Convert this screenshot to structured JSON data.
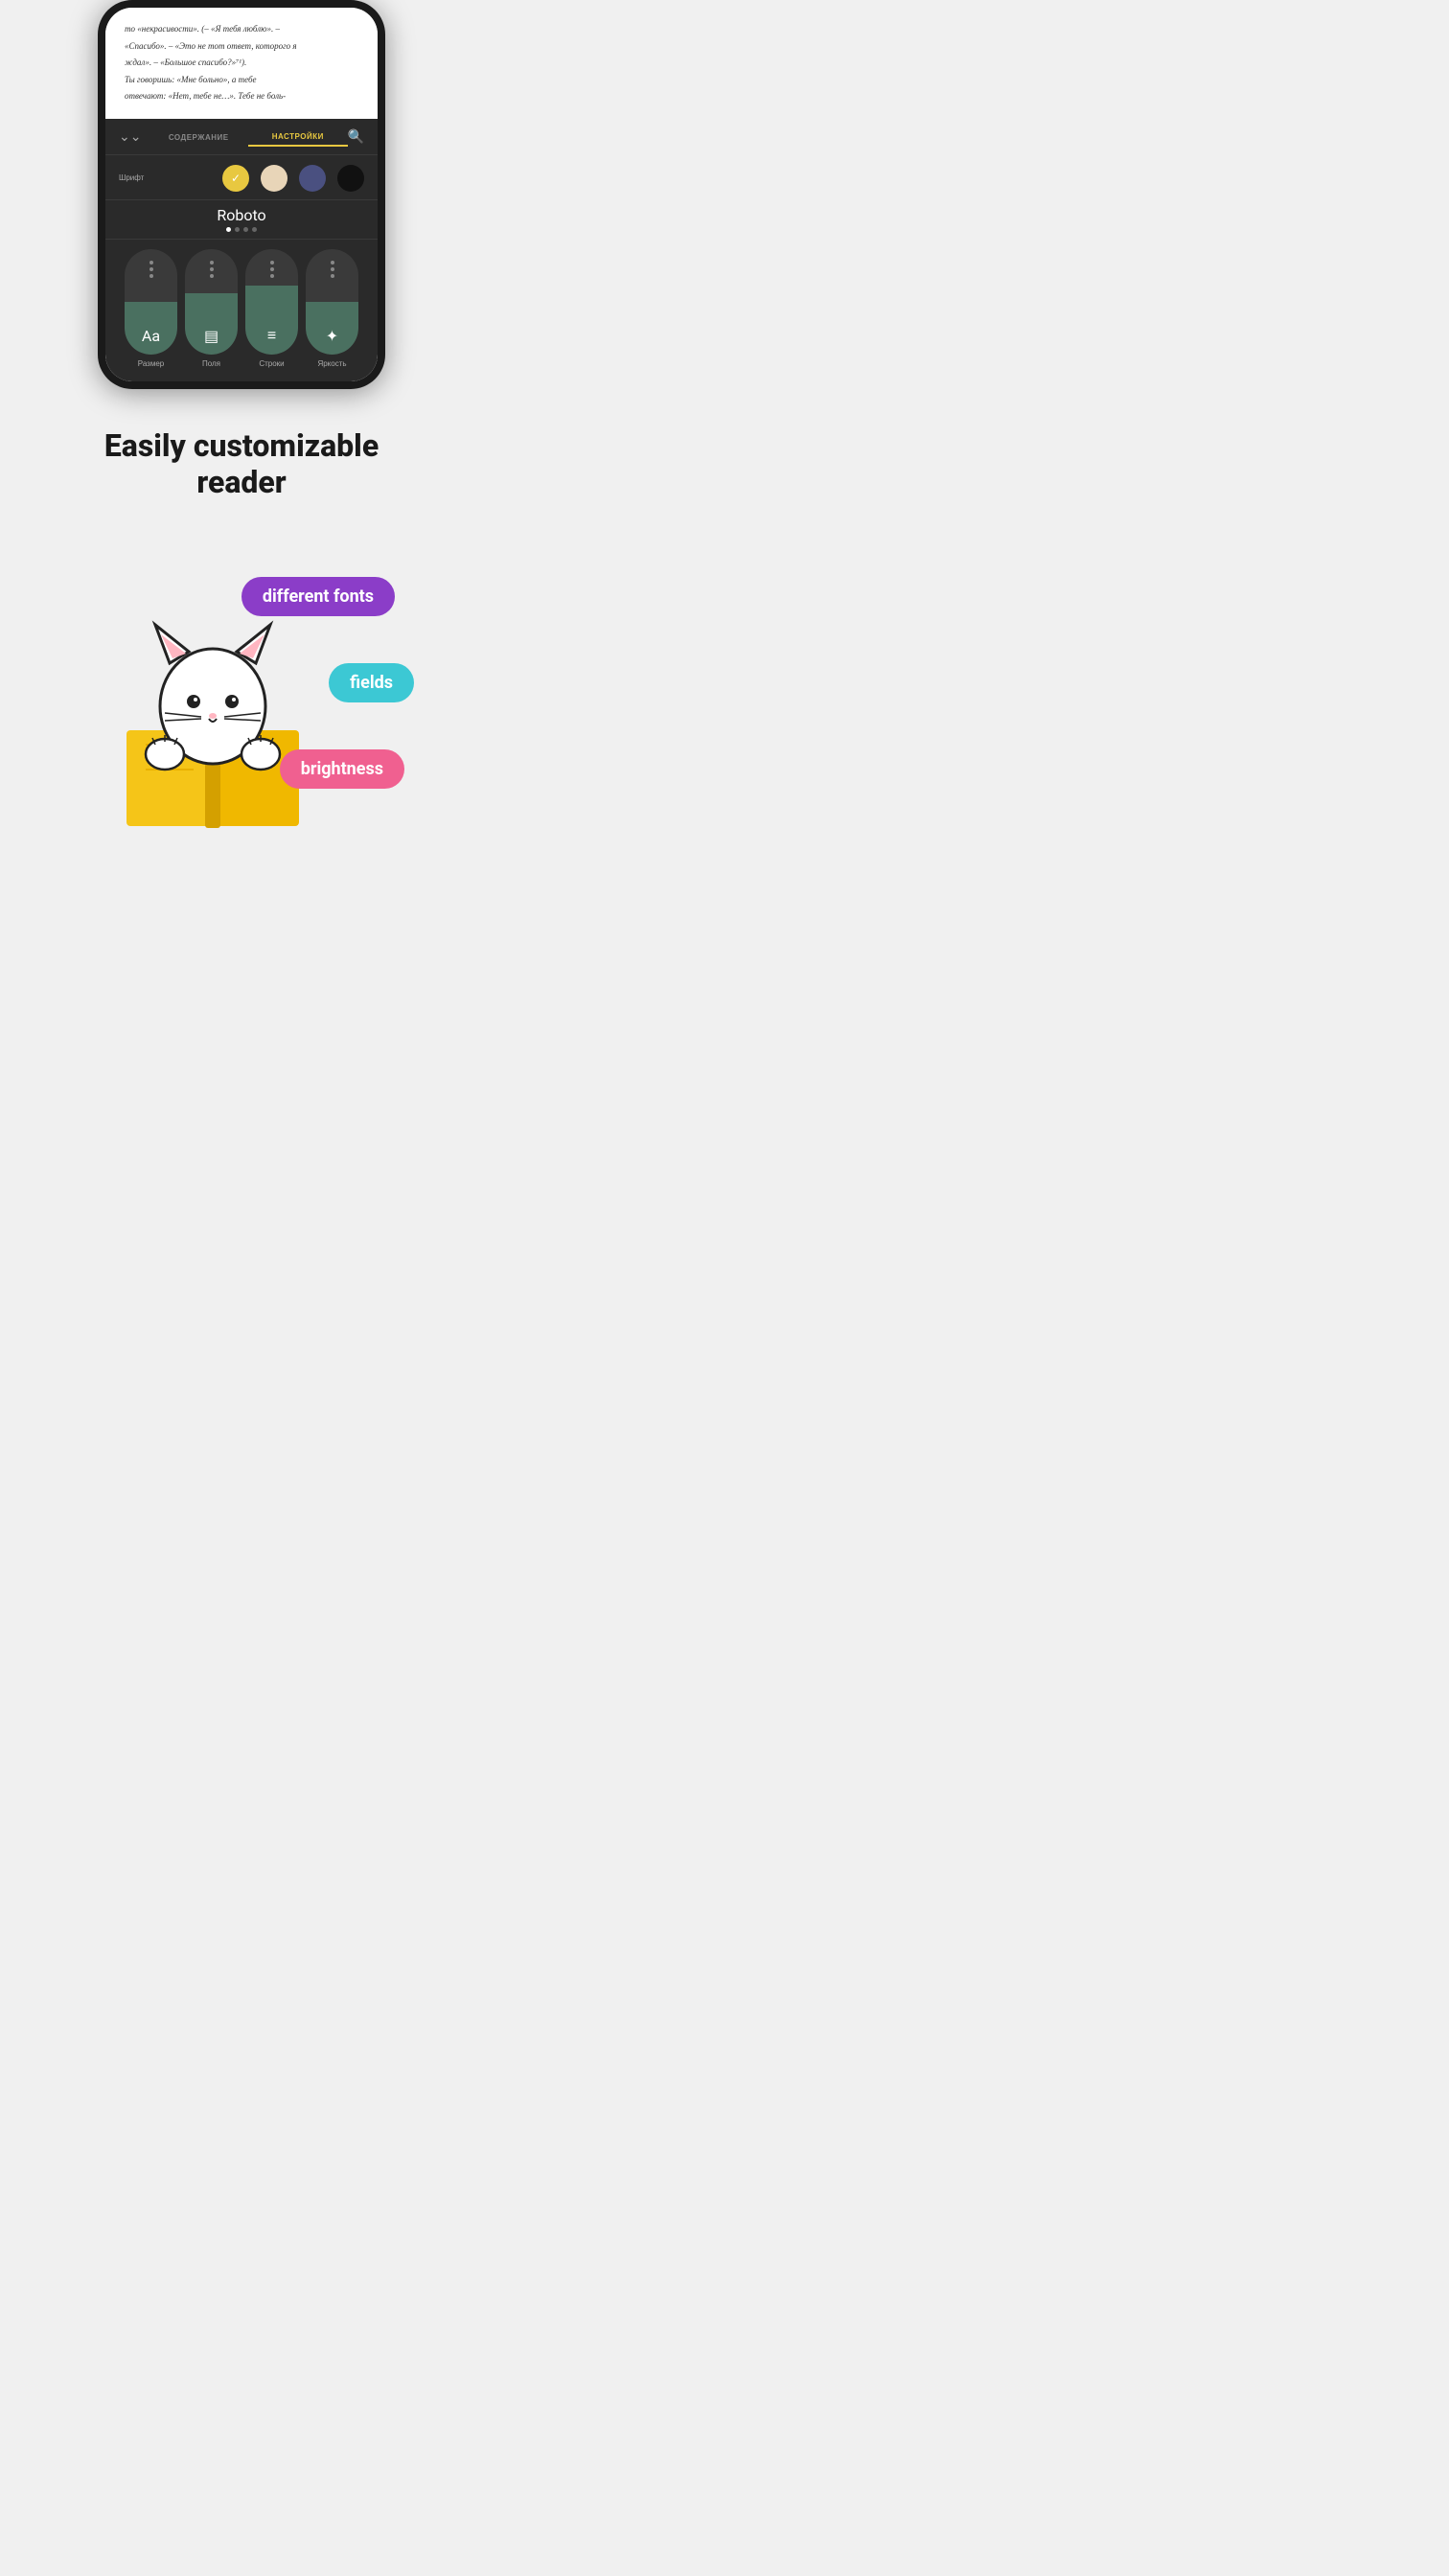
{
  "phone": {
    "bookText": {
      "line1": "то «некрасивости». (– «Я тебя люблю». –",
      "line2": "«Спасибо». – «Это не тот ответ, которого я",
      "line3": "ждал». – «Большое спасибо?»⁷¹).",
      "line4": "Ты говоришь: «Мне больно», а тебе",
      "line5": "отвечают: «Нет, тебе не…». Тебе не боль-"
    },
    "tabs": {
      "contents": "СОДЕРЖАНИЕ",
      "settings": "НАСТРОЙКИ"
    },
    "fontName": "Roboto",
    "fontLabel": "Шрифт",
    "controls": [
      {
        "label": "Размер",
        "icon": "Aa",
        "fillLevel": "filled-1"
      },
      {
        "label": "Поля",
        "icon": "▤",
        "fillLevel": "filled-2"
      },
      {
        "label": "Строки",
        "icon": "≡",
        "fillLevel": "filled-3"
      },
      {
        "label": "Яркость",
        "icon": "✦",
        "fillLevel": "filled-4"
      }
    ]
  },
  "headline": {
    "line1": "Easily customizable",
    "line2": "reader"
  },
  "badges": {
    "fonts": "different fonts",
    "fields": "fields",
    "brightness": "brightness"
  },
  "colors": {
    "badgeFonts": "#8b3dc8",
    "badgeFields": "#3cc8d4",
    "badgeBrightness": "#f06090"
  }
}
